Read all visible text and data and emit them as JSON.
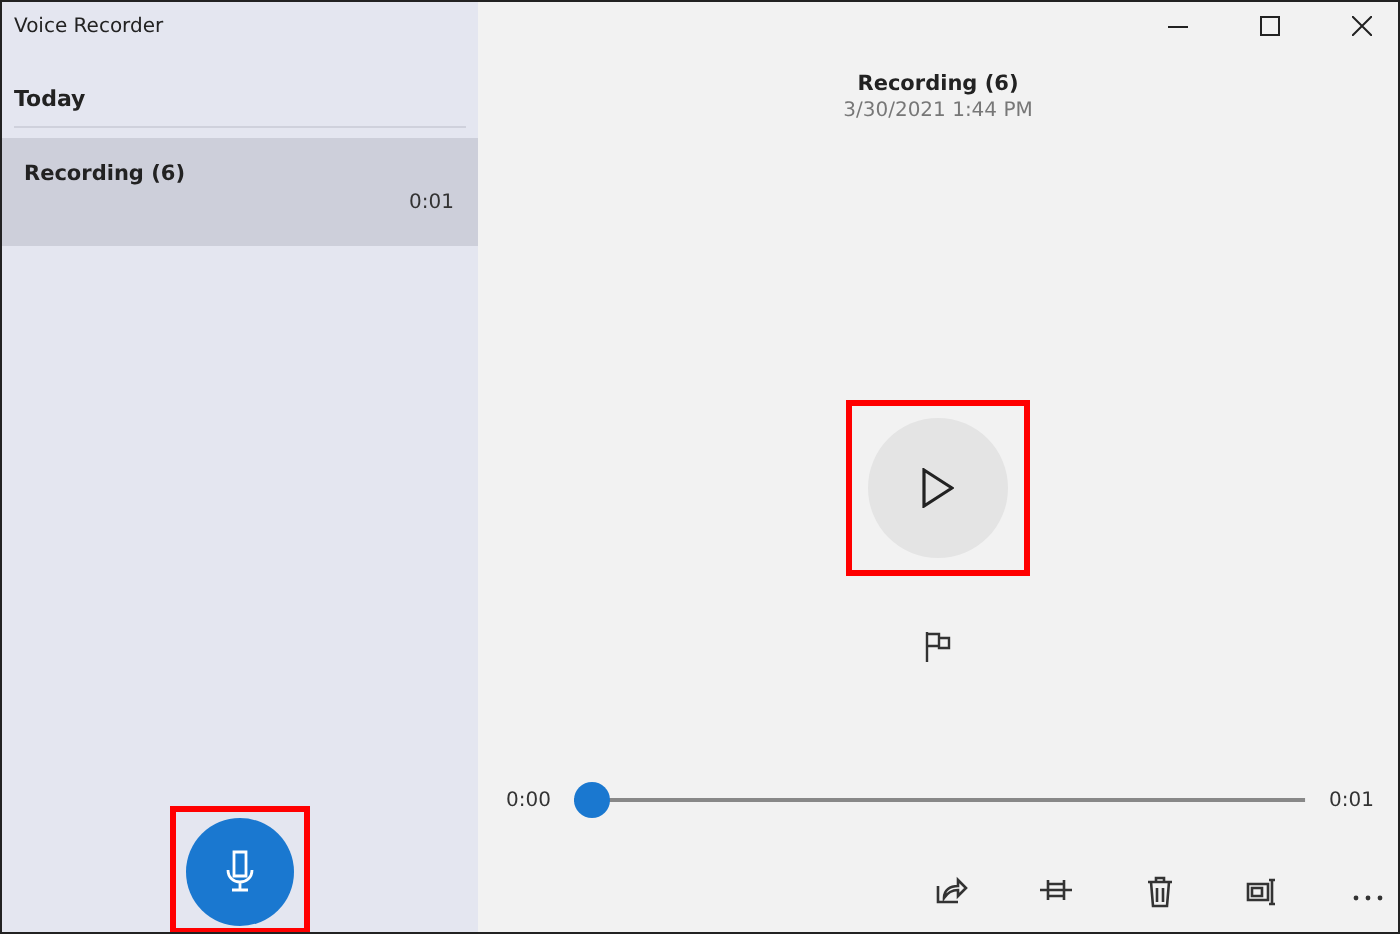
{
  "window": {
    "title": "Voice Recorder"
  },
  "sidebar": {
    "group": "Today",
    "recordings": [
      {
        "name": "Recording (6)",
        "duration": "0:01",
        "selected": true
      }
    ]
  },
  "record_button": {
    "highlighted": true
  },
  "detail": {
    "title": "Recording (6)",
    "date": "3/30/2021 1:44 PM",
    "play_highlighted": true
  },
  "playback": {
    "start": "0:00",
    "end": "0:01",
    "level": 0
  },
  "toolbar": [
    {
      "kind": "share"
    },
    {
      "kind": "trim"
    },
    {
      "kind": "delete"
    },
    {
      "kind": "rename"
    },
    {
      "kind": "more"
    }
  ]
}
